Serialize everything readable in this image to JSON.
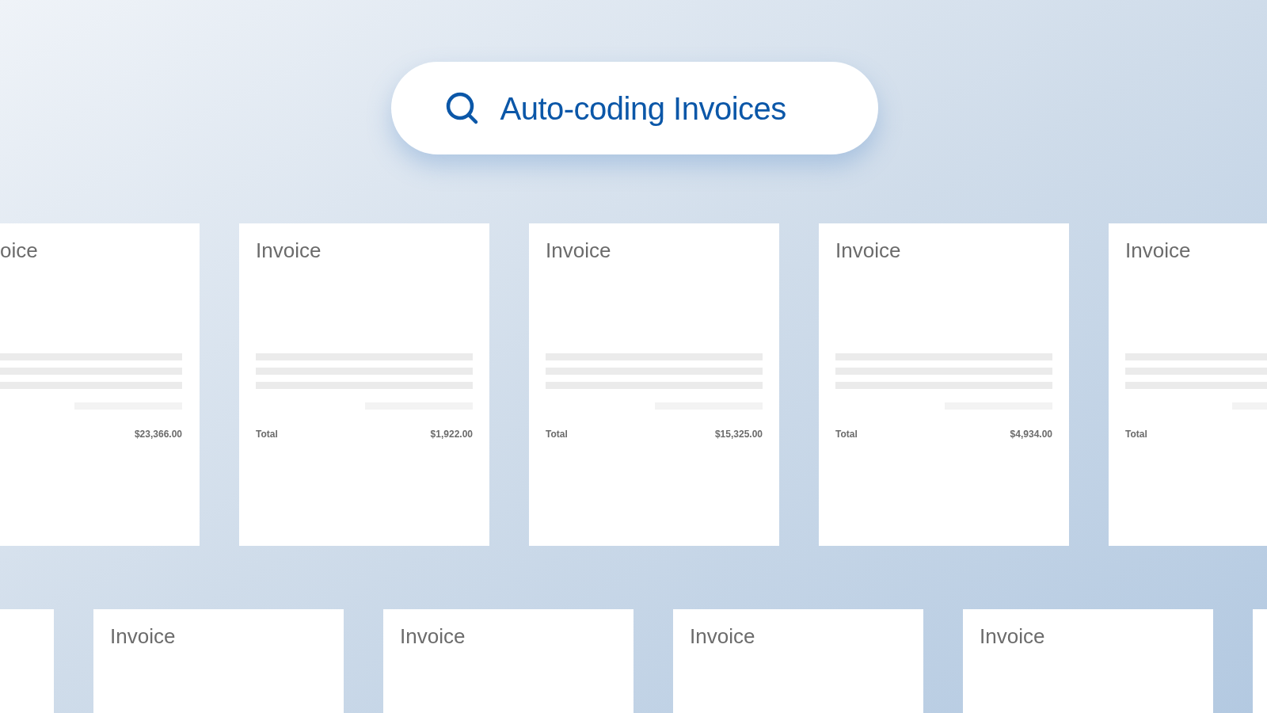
{
  "search": {
    "query": "Auto-coding Invoices"
  },
  "rows": [
    {
      "cards": [
        {
          "kind": "cut_left",
          "title": "oice",
          "total_amount": "$23,366.00"
        },
        {
          "kind": "full",
          "title": "Invoice",
          "total_label": "Total",
          "total_amount": "$1,922.00"
        },
        {
          "kind": "full",
          "title": "Invoice",
          "total_label": "Total",
          "total_amount": "$15,325.00"
        },
        {
          "kind": "full",
          "title": "Invoice",
          "total_label": "Total",
          "total_amount": "$4,934.00"
        },
        {
          "kind": "cut_right",
          "title": "Invoice",
          "total_label": "Total"
        }
      ]
    },
    {
      "cards": [
        {
          "kind": "cut_left"
        },
        {
          "kind": "full",
          "title": "Invoice"
        },
        {
          "kind": "full",
          "title": "Invoice"
        },
        {
          "kind": "full",
          "title": "Invoice"
        },
        {
          "kind": "full",
          "title": "Invoice"
        },
        {
          "kind": "cut_right"
        }
      ]
    }
  ]
}
